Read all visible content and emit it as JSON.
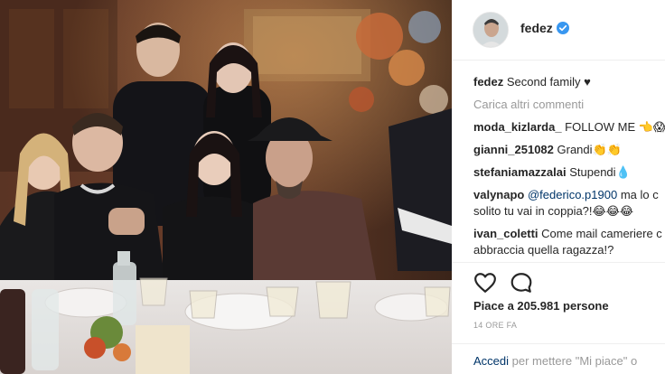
{
  "post": {
    "author": "fedez",
    "verified_icon": "verified-badge-icon",
    "caption_user": "fedez",
    "caption_text": "Second family",
    "caption_heart": "♥",
    "load_more": "Carica altri commenti"
  },
  "comments": [
    {
      "user": "moda_kizlarda_",
      "text": "FOLLOW ME 👈😱"
    },
    {
      "user": "gianni_251082",
      "text": "Grandi👏👏"
    },
    {
      "user": "stefaniamazzalai",
      "text": "Stupendi💧"
    },
    {
      "user": "valynapo",
      "mention": "@federico.p1900",
      "text": "ma lo c",
      "text_line2": "solito tu vai in coppia?!😂😂😂"
    },
    {
      "user": "ivan_coletti",
      "text": "Come mail cameriere c",
      "text_line2": "abbraccia quella ragazza!?"
    }
  ],
  "actions": {
    "like_icon": "heart-outline-icon",
    "comment_icon": "comment-bubble-icon",
    "likes": "Piace a 205.981 persone",
    "time": "14 ORE FA"
  },
  "login": {
    "link": "Accedi",
    "rest": "per mettere \"Mi piace\" o"
  },
  "colors": {
    "link": "#003569",
    "muted": "#999999",
    "verified": "#3897f0",
    "border": "#efefef"
  }
}
